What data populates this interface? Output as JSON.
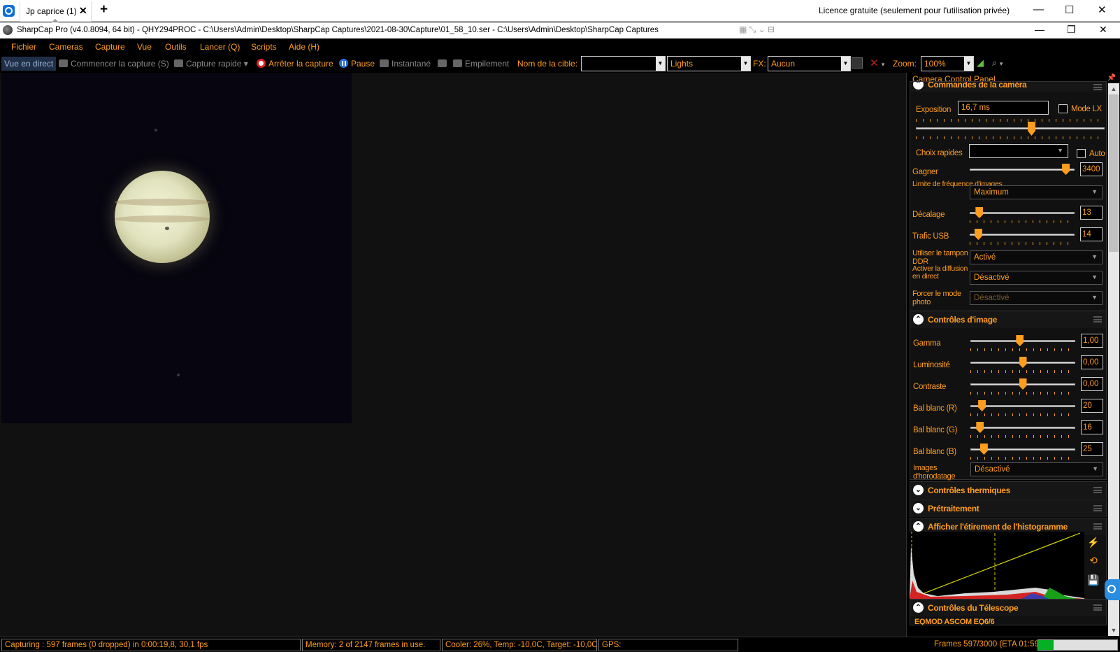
{
  "remote": {
    "tab_label": "Jp caprice (1)",
    "tab_close": "✕",
    "new_tab": "+",
    "license": "Licence gratuite (seulement pour l'utilisation privée)",
    "minimize": "—",
    "maximize": "☐",
    "close": "✕"
  },
  "window": {
    "title": "SharpCap Pro (v4.0.8094, 64 bit) - QHY294PROC - C:\\Users\\Admin\\Desktop\\SharpCap Captures\\2021-08-30\\Capture\\01_58_10.ser - C:\\Users\\Admin\\Desktop\\SharpCap Captures",
    "minimize": "—",
    "restore": "❐",
    "close": "✕"
  },
  "menu": [
    "Fichier",
    "Cameras",
    "Capture",
    "Vue",
    "Outils",
    "Lancer (Q)",
    "Scripts",
    "Aide (H)"
  ],
  "toolbar": {
    "live_view": "Vue en direct",
    "start_capture": "Commencer la capture (S)",
    "quick_capture": "Capture rapide",
    "stop_capture": "Arrêter la capture",
    "pause": "Pause",
    "snapshot": "Instantané",
    "stacking": "Empilement",
    "target_label": "Nom de la cible:",
    "target_value": "",
    "frame_type": "Lights",
    "fx_label": "FX:",
    "fx_value": "Aucun",
    "zoom_label": "Zoom:",
    "zoom_value": "100%"
  },
  "panel": {
    "title": "Camera Control Panel",
    "camera_controls": {
      "title": "Commandes de la caméra",
      "exposure_label": "Exposition",
      "exposure_value": "16,7 ms",
      "lx_mode": "Mode LX",
      "quick_picks": "Choix rapides",
      "auto": "Auto",
      "gain_label": "Gagner",
      "gain_value": "3400",
      "gain_level": 0.95,
      "frame_limit_label": "Limite de fréquence d'images",
      "frame_limit_value": "Maximum",
      "offset_label": "Décalage",
      "offset_value": "13",
      "offset_level": 0.06,
      "usb_label": "Trafic USB",
      "usb_value": "14",
      "usb_level": 0.05,
      "ddr_label": "Utiliser le tampon DDR",
      "ddr_value": "Activé",
      "broadcast_label": "Activer la diffusion en direct",
      "broadcast_value": "Désactivé",
      "photo_label": "Forcer le mode photo",
      "photo_value": "Désactivé"
    },
    "image_controls": {
      "title": "Contrôles d'image",
      "gamma_label": "Gamma",
      "gamma_value": "1,00",
      "gamma_level": 0.47,
      "brightness_label": "Luminosité",
      "brightness_value": "0,00",
      "brightness_level": 0.5,
      "contrast_label": "Contraste",
      "contrast_value": "0,00",
      "contrast_level": 0.5,
      "wb_r_label": "Bal blanc (R)",
      "wb_r_value": "20",
      "wb_r_level": 0.08,
      "wb_g_label": "Bal blanc (G)",
      "wb_g_value": "16",
      "wb_g_level": 0.06,
      "wb_b_label": "Bal blanc (B)",
      "wb_b_value": "25",
      "wb_b_level": 0.1,
      "timestamp_label": "Images d'horodatage",
      "timestamp_value": "Désactivé"
    },
    "thermal": "Contrôles thermiques",
    "preprocess": "Prétraitement",
    "histogram": "Afficher l'étirement de l'histogramme",
    "telescope": "Contrôles du Télescope",
    "telescope_device": "EQMOD ASCOM EQ6/6"
  },
  "status": {
    "capturing": "Capturing : 597 frames (0 dropped) in 0:00:19,8, 30,1 fps",
    "memory": "Memory: 2 of 2147 frames in use.",
    "cooler": "Cooler: 26%, Temp: -10,0C, Target: -10,0C",
    "gps": "GPS:",
    "frames": "Frames 597/3000 (ETA 01:59)",
    "progress": 0.199
  },
  "colors": {
    "accent": "#ff9d1e",
    "progress": "#06b025"
  }
}
